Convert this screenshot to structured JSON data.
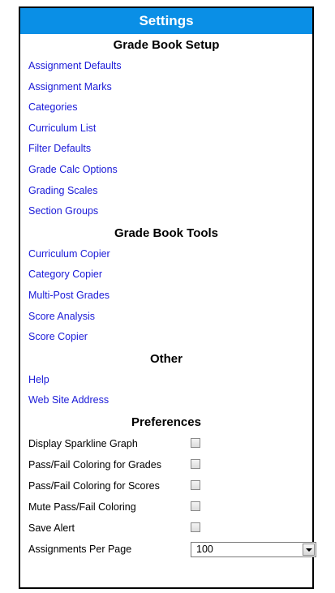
{
  "title": "Settings",
  "sections": {
    "setup": {
      "header": "Grade Book Setup",
      "links": [
        "Assignment Defaults",
        "Assignment Marks",
        "Categories",
        "Curriculum List",
        "Filter Defaults",
        "Grade Calc Options",
        "Grading Scales",
        "Section Groups"
      ]
    },
    "tools": {
      "header": "Grade Book Tools",
      "links": [
        "Curriculum Copier",
        "Category Copier",
        "Multi-Post Grades",
        "Score Analysis",
        "Score Copier"
      ]
    },
    "other": {
      "header": "Other",
      "links": [
        "Help",
        "Web Site Address"
      ]
    },
    "preferences": {
      "header": "Preferences",
      "items": [
        {
          "label": "Display Sparkline Graph",
          "checked": false
        },
        {
          "label": "Pass/Fail Coloring for Grades",
          "checked": false
        },
        {
          "label": "Pass/Fail Coloring for Scores",
          "checked": false
        },
        {
          "label": "Mute Pass/Fail Coloring",
          "checked": false
        },
        {
          "label": "Save Alert",
          "checked": false
        }
      ],
      "per_page": {
        "label": "Assignments Per Page",
        "value": "100"
      }
    }
  },
  "colors": {
    "titlebar": "#0a8fe6",
    "link": "#1a1ad8"
  }
}
